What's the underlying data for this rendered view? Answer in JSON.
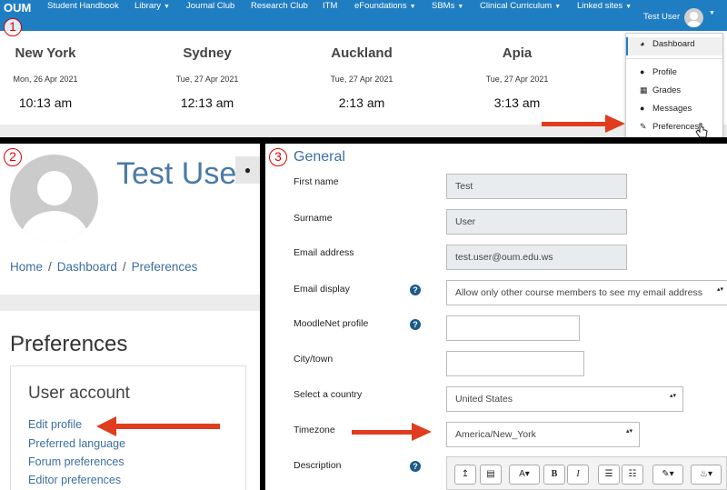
{
  "navbar": {
    "brand": "OUM",
    "items": [
      "Student Handbook",
      "Library",
      "Journal Club",
      "Research Club",
      "ITM",
      "eFoundations",
      "SBMs",
      "Clinical Curriculum",
      "Linked sites"
    ],
    "user_name": "Test User"
  },
  "clocks": [
    {
      "city": "New York",
      "date": "Mon, 26 Apr 2021",
      "time": "10:13 am"
    },
    {
      "city": "Sydney",
      "date": "Tue, 27 Apr 2021",
      "time": "12:13 am"
    },
    {
      "city": "Auckland",
      "date": "Tue, 27 Apr 2021",
      "time": "2:13 am"
    },
    {
      "city": "Apia",
      "date": "Tue, 27 Apr 2021",
      "time": "3:13 am"
    }
  ],
  "user_dropdown": {
    "items": [
      "Dashboard",
      "Profile",
      "Grades",
      "Messages",
      "Preferences"
    ]
  },
  "step_badges": [
    "1",
    "2",
    "3"
  ],
  "profile": {
    "name": "Test User",
    "breadcrumb": [
      "Home",
      "Dashboard",
      "Preferences"
    ],
    "preferences_title": "Preferences",
    "user_account_title": "User account",
    "links": [
      "Edit profile",
      "Preferred language",
      "Forum preferences",
      "Editor preferences"
    ]
  },
  "form": {
    "section_title": "General",
    "first_name_label": "First name",
    "first_name_value": "Test",
    "surname_label": "Surname",
    "surname_value": "User",
    "email_label": "Email address",
    "email_value": "test.user@oum.edu.ws",
    "email_display_label": "Email display",
    "email_display_value": "Allow only other course members to see my email address",
    "moodlenet_label": "MoodleNet profile",
    "city_label": "City/town",
    "country_label": "Select a country",
    "country_value": "United States",
    "timezone_label": "Timezone",
    "timezone_value": "America/New_York",
    "description_label": "Description"
  },
  "colors": {
    "navbar": "#1f7dc2",
    "link": "#3d6fa0",
    "arrow": "#e03c1f",
    "badge": "#dd0000"
  }
}
